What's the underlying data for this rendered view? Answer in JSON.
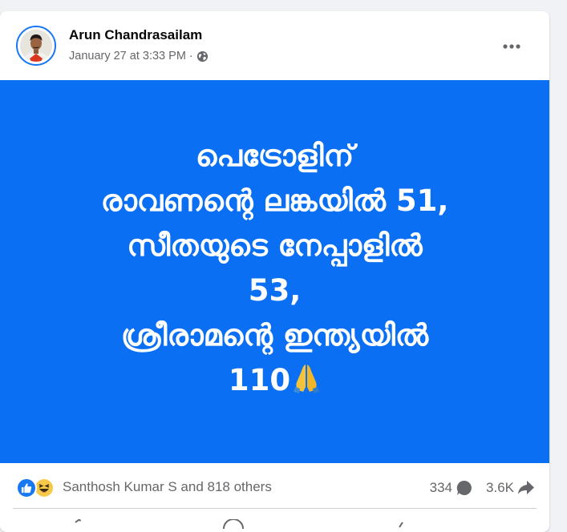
{
  "post": {
    "author": "Arun Chandrasailam",
    "timestamp": "January 27 at 3:33 PM",
    "separator": "·",
    "audience_icon": "globe-icon",
    "more_icon": "more-horizontal-icon",
    "image_text_lines": [
      "പെട്രോളിന്",
      "രാവണന്റെ ലങ്കയിൽ 51,",
      "സീതയുടെ നേപ്പാളിൽ",
      "53,",
      "ശ്രീരാമന്റെ ഇന്ത്യയിൽ",
      "110"
    ],
    "image_bg_color": "#0a6ff2",
    "emoji_icon": "folded-hands-icon"
  },
  "reactions": {
    "icons": [
      "like-icon",
      "haha-icon"
    ],
    "summary": "Santhosh Kumar S and 818 others",
    "comments_count": "334",
    "shares_count": "3.6K"
  },
  "colors": {
    "accent": "#1877f2",
    "secondary_text": "#65676b",
    "primary_text": "#050505"
  }
}
